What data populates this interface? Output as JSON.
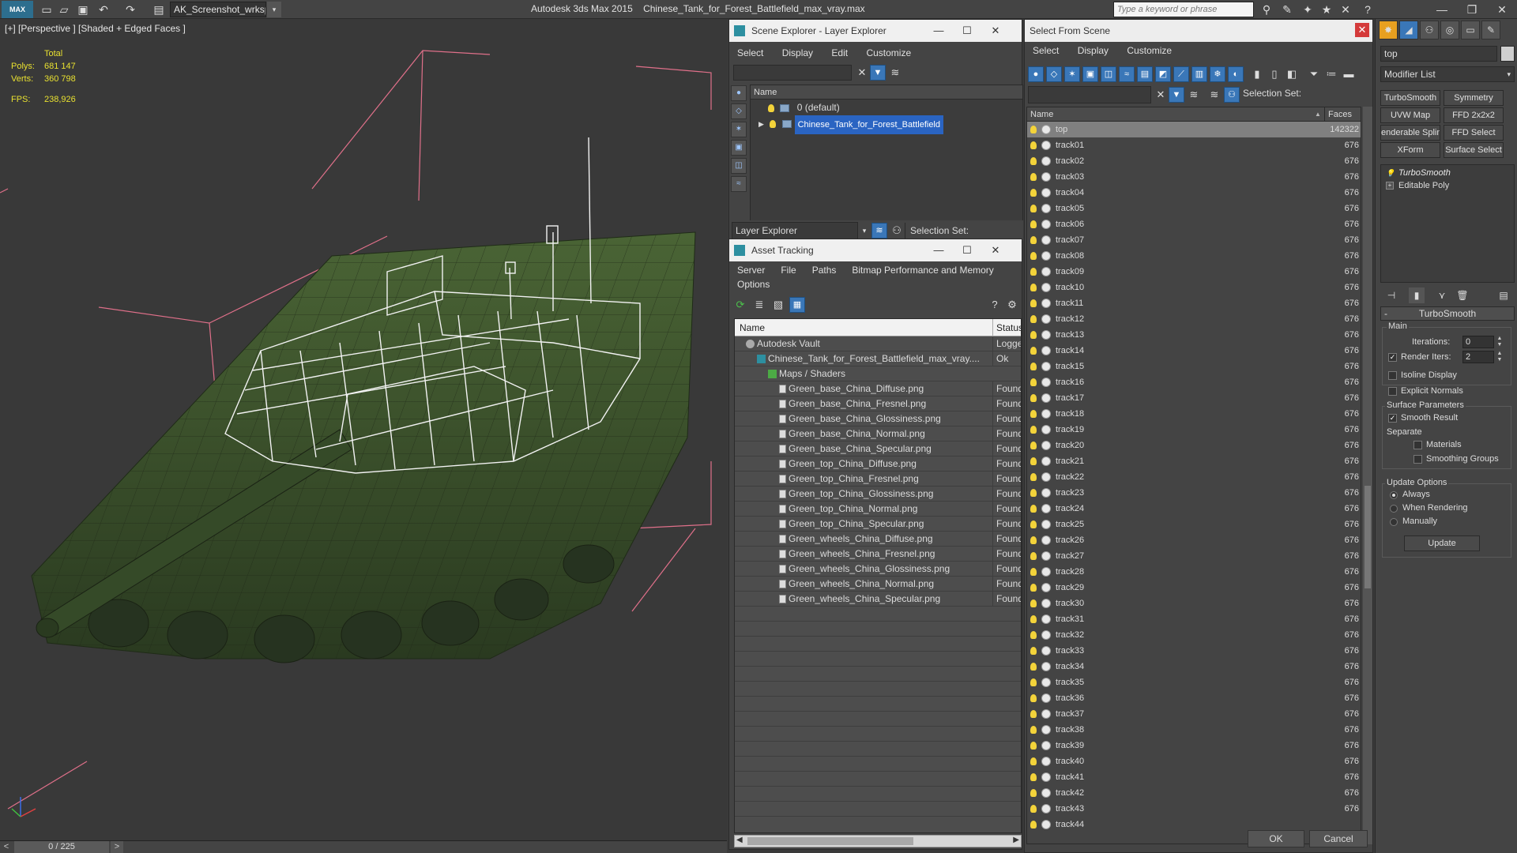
{
  "titlebar": {
    "workspace": "AK_Screenshot_wrksp",
    "app_name": "Autodesk 3ds Max  2015",
    "file_name": "Chinese_Tank_for_Forest_Battlefield_max_vray.max",
    "search_placeholder": "Type a keyword or phrase",
    "logo": "MAX"
  },
  "viewport": {
    "label": "[+] [Perspective ] [Shaded + Edged Faces ]",
    "stats": {
      "total_label": "Total",
      "polys_label": "Polys:",
      "polys": "681 147",
      "verts_label": "Verts:",
      "verts": "360 798",
      "fps_label": "FPS:",
      "fps": "238,926"
    }
  },
  "timeline": {
    "frame": "0 / 225",
    "left_arrow": "<",
    "right_arrow": ">"
  },
  "scene_explorer": {
    "title": "Scene Explorer - Layer Explorer",
    "menu": [
      "Select",
      "Display",
      "Edit",
      "Customize"
    ],
    "column": "Name",
    "rows": [
      "0 (default)",
      "Chinese_Tank_for_Forest_Battlefield"
    ],
    "explorer_dropdown": "Layer Explorer",
    "selection_set_label": "Selection Set:"
  },
  "asset_tracking": {
    "title": "Asset Tracking",
    "menu_row1": [
      "Server",
      "File",
      "Paths",
      "Bitmap Performance and Memory"
    ],
    "menu_row2": [
      "Options"
    ],
    "columns": [
      "Name",
      "Status"
    ],
    "rows": [
      {
        "name": "Autodesk Vault",
        "status": "Logged",
        "indent": 0,
        "icon": "vault"
      },
      {
        "name": "Chinese_Tank_for_Forest_Battlefield_max_vray....",
        "status": "Ok",
        "indent": 1,
        "icon": "max"
      },
      {
        "name": "Maps / Shaders",
        "status": "",
        "indent": 2,
        "icon": "map"
      },
      {
        "name": "Green_base_China_Diffuse.png",
        "status": "Found",
        "indent": 3,
        "icon": "file"
      },
      {
        "name": "Green_base_China_Fresnel.png",
        "status": "Found",
        "indent": 3,
        "icon": "file"
      },
      {
        "name": "Green_base_China_Glossiness.png",
        "status": "Found",
        "indent": 3,
        "icon": "file"
      },
      {
        "name": "Green_base_China_Normal.png",
        "status": "Found",
        "indent": 3,
        "icon": "file"
      },
      {
        "name": "Green_base_China_Specular.png",
        "status": "Found",
        "indent": 3,
        "icon": "file"
      },
      {
        "name": "Green_top_China_Diffuse.png",
        "status": "Found",
        "indent": 3,
        "icon": "file"
      },
      {
        "name": "Green_top_China_Fresnel.png",
        "status": "Found",
        "indent": 3,
        "icon": "file"
      },
      {
        "name": "Green_top_China_Glossiness.png",
        "status": "Found",
        "indent": 3,
        "icon": "file"
      },
      {
        "name": "Green_top_China_Normal.png",
        "status": "Found",
        "indent": 3,
        "icon": "file"
      },
      {
        "name": "Green_top_China_Specular.png",
        "status": "Found",
        "indent": 3,
        "icon": "file"
      },
      {
        "name": "Green_wheels_China_Diffuse.png",
        "status": "Found",
        "indent": 3,
        "icon": "file"
      },
      {
        "name": "Green_wheels_China_Fresnel.png",
        "status": "Found",
        "indent": 3,
        "icon": "file"
      },
      {
        "name": "Green_wheels_China_Glossiness.png",
        "status": "Found",
        "indent": 3,
        "icon": "file"
      },
      {
        "name": "Green_wheels_China_Normal.png",
        "status": "Found",
        "indent": 3,
        "icon": "file"
      },
      {
        "name": "Green_wheels_China_Specular.png",
        "status": "Found",
        "indent": 3,
        "icon": "file"
      }
    ],
    "empty_rows": 14
  },
  "select_from_scene": {
    "title": "Select From Scene",
    "menu": [
      "Select",
      "Display",
      "Customize"
    ],
    "selection_set_label": "Selection Set:",
    "columns": [
      "Name",
      "Faces"
    ],
    "rows": [
      {
        "name": "top",
        "faces": "142322",
        "selected": true
      },
      {
        "name": "track01",
        "faces": "676"
      },
      {
        "name": "track02",
        "faces": "676"
      },
      {
        "name": "track03",
        "faces": "676"
      },
      {
        "name": "track04",
        "faces": "676"
      },
      {
        "name": "track05",
        "faces": "676"
      },
      {
        "name": "track06",
        "faces": "676"
      },
      {
        "name": "track07",
        "faces": "676"
      },
      {
        "name": "track08",
        "faces": "676"
      },
      {
        "name": "track09",
        "faces": "676"
      },
      {
        "name": "track10",
        "faces": "676"
      },
      {
        "name": "track11",
        "faces": "676"
      },
      {
        "name": "track12",
        "faces": "676"
      },
      {
        "name": "track13",
        "faces": "676"
      },
      {
        "name": "track14",
        "faces": "676"
      },
      {
        "name": "track15",
        "faces": "676"
      },
      {
        "name": "track16",
        "faces": "676"
      },
      {
        "name": "track17",
        "faces": "676"
      },
      {
        "name": "track18",
        "faces": "676"
      },
      {
        "name": "track19",
        "faces": "676"
      },
      {
        "name": "track20",
        "faces": "676"
      },
      {
        "name": "track21",
        "faces": "676"
      },
      {
        "name": "track22",
        "faces": "676"
      },
      {
        "name": "track23",
        "faces": "676"
      },
      {
        "name": "track24",
        "faces": "676"
      },
      {
        "name": "track25",
        "faces": "676"
      },
      {
        "name": "track26",
        "faces": "676"
      },
      {
        "name": "track27",
        "faces": "676"
      },
      {
        "name": "track28",
        "faces": "676"
      },
      {
        "name": "track29",
        "faces": "676"
      },
      {
        "name": "track30",
        "faces": "676"
      },
      {
        "name": "track31",
        "faces": "676"
      },
      {
        "name": "track32",
        "faces": "676"
      },
      {
        "name": "track33",
        "faces": "676"
      },
      {
        "name": "track34",
        "faces": "676"
      },
      {
        "name": "track35",
        "faces": "676"
      },
      {
        "name": "track36",
        "faces": "676"
      },
      {
        "name": "track37",
        "faces": "676"
      },
      {
        "name": "track38",
        "faces": "676"
      },
      {
        "name": "track39",
        "faces": "676"
      },
      {
        "name": "track40",
        "faces": "676"
      },
      {
        "name": "track41",
        "faces": "676"
      },
      {
        "name": "track42",
        "faces": "676"
      },
      {
        "name": "track43",
        "faces": "676"
      },
      {
        "name": "track44",
        "faces": ""
      }
    ],
    "ok_label": "OK",
    "cancel_label": "Cancel"
  },
  "command_panel": {
    "object_name": "top",
    "modifier_list": "Modifier List",
    "modifier_buttons": [
      "TurboSmooth",
      "Symmetry",
      "UVW Map",
      "FFD 2x2x2",
      "enderable Splin",
      "FFD Select",
      "XForm",
      "Surface Select"
    ],
    "stack": [
      "TurboSmooth",
      "Editable Poly"
    ],
    "rollout_title": "TurboSmooth",
    "rollout_minus": "-",
    "main_group": "Main",
    "iterations_label": "Iterations:",
    "iterations": "0",
    "render_iters_label": "Render Iters:",
    "render_iters": "2",
    "render_iters_checked": true,
    "isoline_label": "Isoline Display",
    "explicit_normals_label": "Explicit Normals",
    "surface_group": "Surface Parameters",
    "smooth_result_label": "Smooth Result",
    "smooth_result_checked": true,
    "separate_label": "Separate",
    "materials_label": "Materials",
    "smoothing_groups_label": "Smoothing Groups",
    "update_group": "Update Options",
    "update_options": [
      "Always",
      "When Rendering",
      "Manually"
    ],
    "update_selected": 0,
    "update_button": "Update"
  },
  "colors": {
    "selection_blue": "#2a64c2",
    "stats_yellow": "#e8e030",
    "bounding_box_pink": "#e0708a",
    "tank_green": "#3f5a2e"
  }
}
